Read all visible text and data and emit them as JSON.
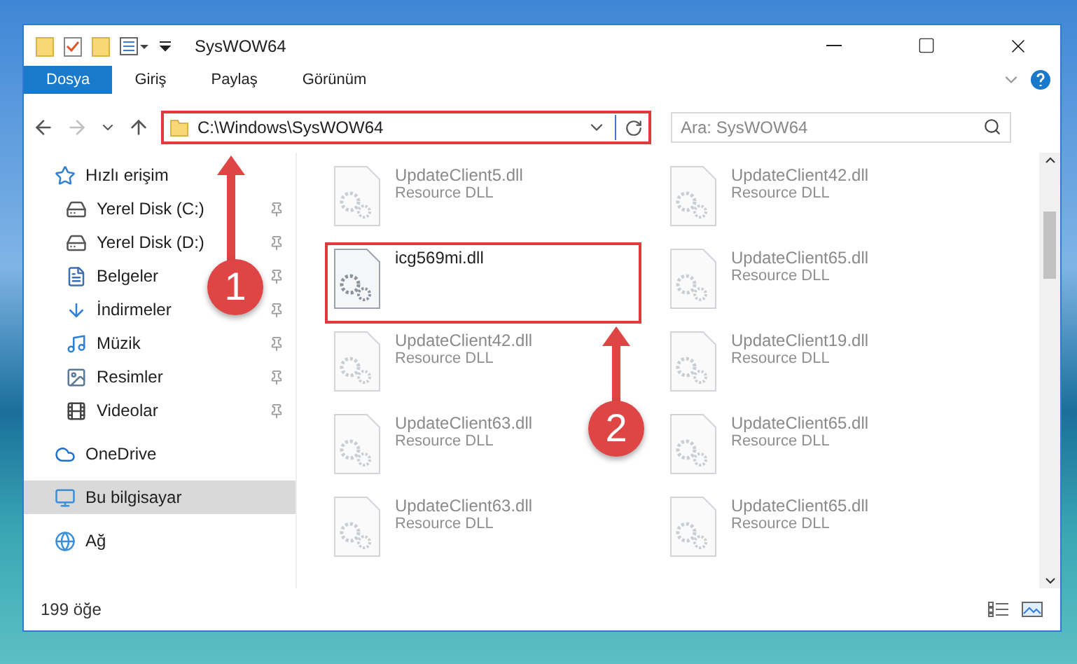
{
  "window": {
    "title": "SysWOW64"
  },
  "ribbon_tabs": [
    {
      "label": "Dosya",
      "selected": true
    },
    {
      "label": "Giriş",
      "selected": false
    },
    {
      "label": "Paylaş",
      "selected": false
    },
    {
      "label": "Görünüm",
      "selected": false
    }
  ],
  "address": {
    "value": "C:\\Windows\\SysWOW64",
    "annotated": true
  },
  "search": {
    "placeholder": "Ara: SysWOW64"
  },
  "sidebar": {
    "items": [
      {
        "label": "Hızlı erişim",
        "selected": false,
        "children": [
          {
            "label": "Yerel Disk (C:)",
            "pinned": true
          },
          {
            "label": "Yerel Disk (D:)",
            "pinned": true
          },
          {
            "label": "Belgeler",
            "pinned": true
          },
          {
            "label": "İndirmeler",
            "pinned": true
          },
          {
            "label": "Müzik",
            "pinned": true
          },
          {
            "label": "Resimler",
            "pinned": true
          },
          {
            "label": "Videolar",
            "pinned": true
          }
        ]
      },
      {
        "label": "OneDrive",
        "selected": false
      },
      {
        "label": "Bu bilgisayar",
        "selected": true
      },
      {
        "label": "Ağ",
        "selected": false
      }
    ]
  },
  "files": [
    {
      "name": "UpdateClient5.dll",
      "type": "Resource DLL",
      "blurred": true,
      "annotated": false
    },
    {
      "name": "UpdateClient42.dll",
      "type": "Resource DLL",
      "blurred": true,
      "annotated": false
    },
    {
      "name": "icg569mi.dll",
      "blurred": false,
      "annotated": true
    },
    {
      "name": "UpdateClient65.dll",
      "type": "Resource DLL",
      "blurred": true,
      "annotated": false
    },
    {
      "name": "UpdateClient42.dll",
      "type": "Resource DLL",
      "blurred": true,
      "annotated": false
    },
    {
      "name": "UpdateClient19.dll",
      "type": "Resource DLL",
      "blurred": true,
      "annotated": false
    },
    {
      "name": "UpdateClient63.dll",
      "type": "Resource DLL",
      "blurred": true,
      "annotated": false
    },
    {
      "name": "UpdateClient65.dll",
      "type": "Resource DLL",
      "blurred": true,
      "annotated": false
    },
    {
      "name": "UpdateClient63.dll",
      "type": "Resource DLL",
      "blurred": true,
      "annotated": false
    },
    {
      "name": "UpdateClient65.dll",
      "type": "Resource DLL",
      "blurred": true,
      "annotated": false
    }
  ],
  "status_bar": {
    "count": "199 öğe"
  },
  "annotations": [
    {
      "number": "1"
    },
    {
      "number": "2"
    }
  ]
}
